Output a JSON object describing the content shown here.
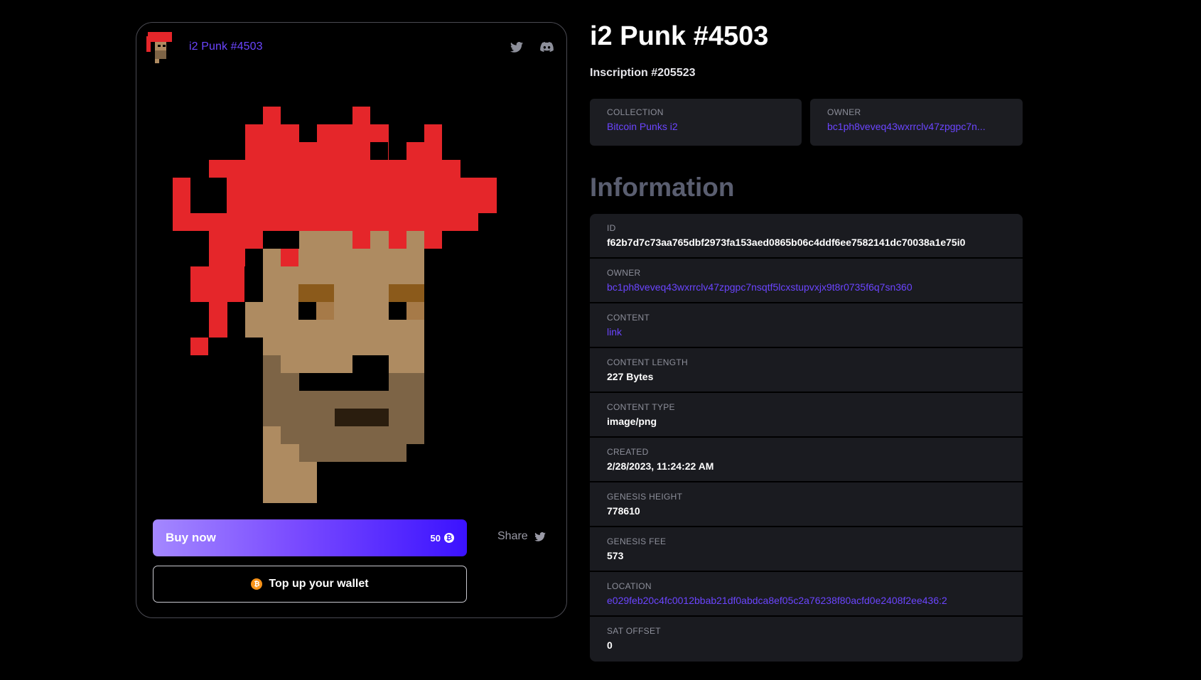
{
  "card": {
    "title": "i2 Punk #4503",
    "icons": [
      "twitter-icon",
      "discord-icon"
    ]
  },
  "actions": {
    "buy_label": "Buy now",
    "price": "50",
    "price_icon": "bitcoin-icon",
    "share_label": "Share",
    "topup_label": "Top up your wallet"
  },
  "header": {
    "title": "i2 Punk #4503",
    "inscription": "Inscription #205523"
  },
  "meta": {
    "collection_label": "COLLECTION",
    "collection_value": "Bitcoin Punks i2",
    "owner_label": "OWNER",
    "owner_value": "bc1ph8veveq43wxrrclv47zpgpc7n..."
  },
  "information": {
    "title": "Information",
    "rows": [
      {
        "label": "ID",
        "value": "f62b7d7c73aa765dbf2973fa153aed0865b06c4ddf6ee7582141dc70038a1e75i0"
      },
      {
        "label": "OWNER",
        "value": "bc1ph8veveq43wxrrclv47zpgpc7nsqtf5lcxstupvxjx9t8r0735f6q7sn360"
      },
      {
        "label": "CONTENT",
        "value": "link"
      },
      {
        "label": "CONTENT LENGTH",
        "value": "227 Bytes"
      },
      {
        "label": "CONTENT TYPE",
        "value": "image/png"
      },
      {
        "label": "CREATED",
        "value": "2/28/2023, 11:24:22 AM"
      },
      {
        "label": "GENESIS HEIGHT",
        "value": "778610"
      },
      {
        "label": "GENESIS FEE",
        "value": "573"
      },
      {
        "label": "LOCATION",
        "value": "e029feb20c4fc0012bbab21df0abdca8ef05c2a76238f80acfd0e2408f2ee436:2"
      },
      {
        "label": "SAT OFFSET",
        "value": "0"
      }
    ]
  },
  "colors": {
    "accent": "#6b45ff",
    "hair": "#e5262a",
    "skin": "#ae8b61",
    "beard": "#7d6446",
    "brow": "#8b5a1b",
    "bitcoin": "#f7931a"
  }
}
